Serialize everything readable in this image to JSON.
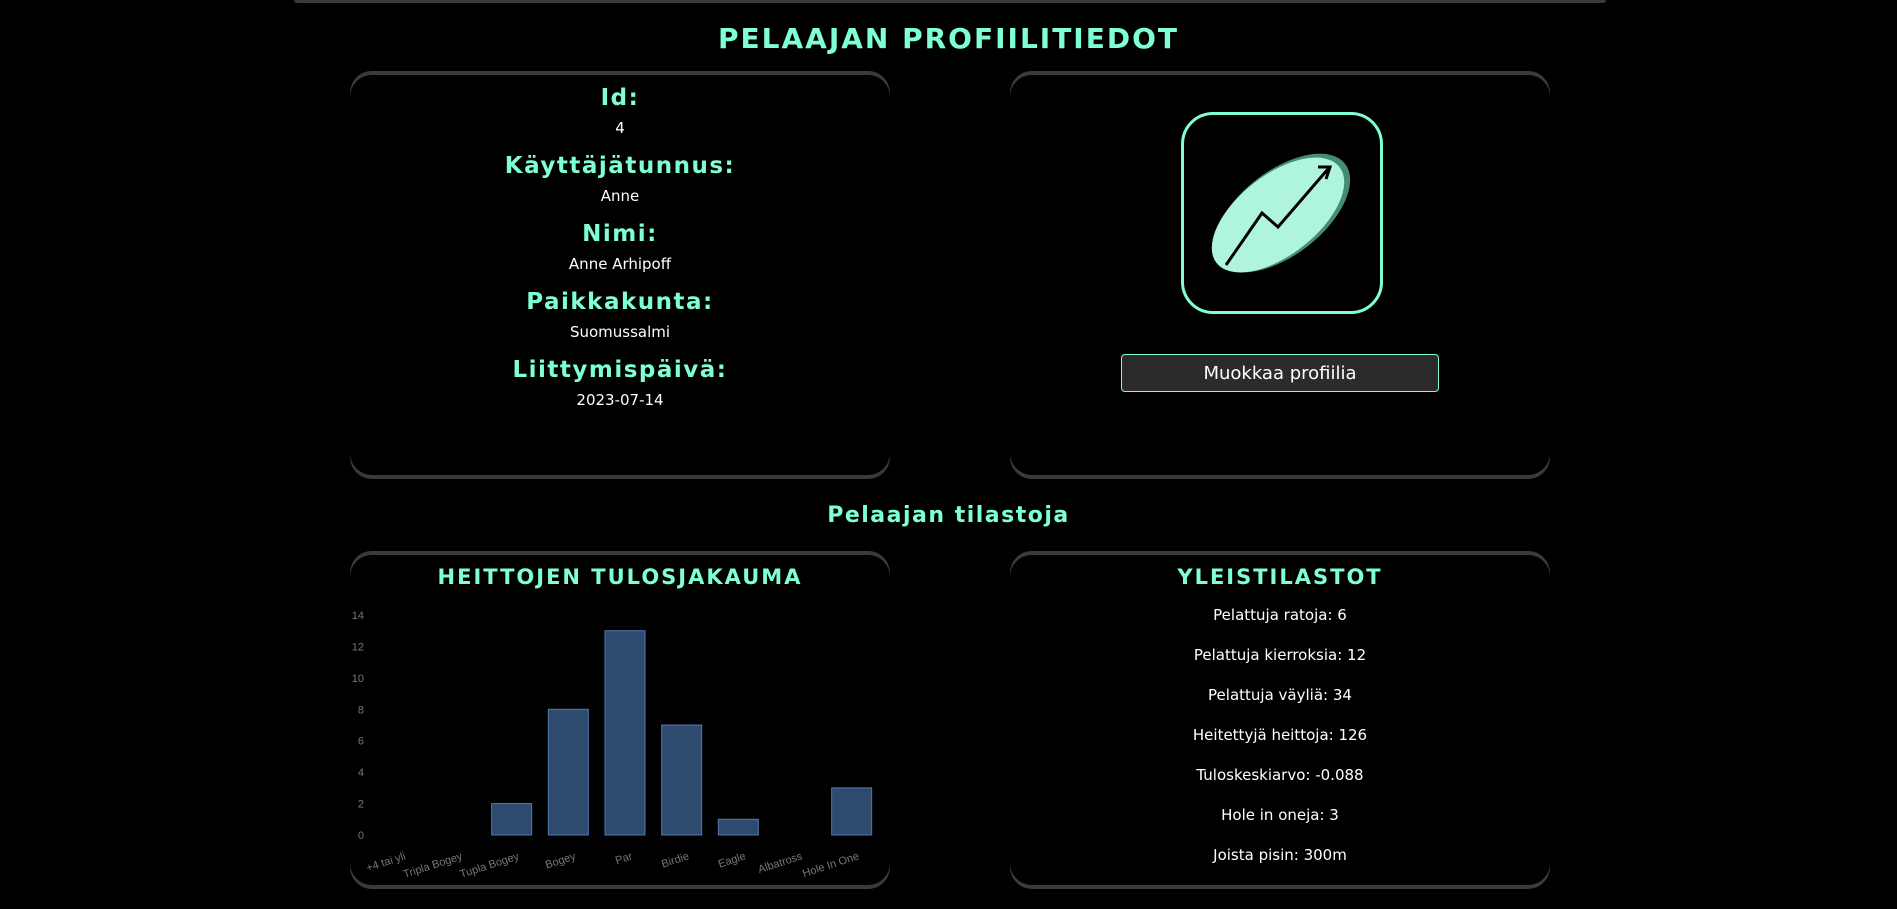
{
  "page_title": "PELAAJAN PROFIILITIEDOT",
  "profile": {
    "fields": [
      {
        "label": "Id:",
        "value": "4"
      },
      {
        "label": "Käyttäjätunnus:",
        "value": "Anne"
      },
      {
        "label": "Nimi:",
        "value": "Anne Arhipoff"
      },
      {
        "label": "Paikkakunta:",
        "value": "Suomussalmi"
      },
      {
        "label": "Liittymispäivä:",
        "value": "2023-07-14"
      }
    ]
  },
  "avatar": {
    "icon": "disc-golf-logo-icon",
    "color": "#7fffd4"
  },
  "edit_button": "Muokkaa profiilia",
  "stats_title": "Pelaajan tilastoja",
  "chart_card_title": "HEITTOJEN TULOSJAKAUMA",
  "general_title": "YLEISTILASTOT",
  "general_stats": [
    "Pelattuja ratoja: 6",
    "Pelattuja kierroksia: 12",
    "Pelattuja väyliä: 34",
    "Heitettyjä heittoja: 126",
    "Tuloskeskiarvo: -0.088",
    "Hole in oneja: 3",
    "Joista pisin: 300m"
  ],
  "colors": {
    "accent": "#7fffd4",
    "bar_fill": "#2e4a6e",
    "bar_stroke": "#4f79b0"
  },
  "chart_data": {
    "type": "bar",
    "categories": [
      "+4 tai yli",
      "Tripla Bogey",
      "Tupla Bogey",
      "Bogey",
      "Par",
      "Birdie",
      "Eagle",
      "Albatross",
      "Hole In One"
    ],
    "values": [
      0,
      0,
      2,
      8,
      13,
      7,
      1,
      0,
      3
    ],
    "ylim": [
      0,
      14
    ],
    "yticks": [
      0,
      2,
      4,
      6,
      8,
      10,
      12,
      14
    ],
    "grid": false
  }
}
